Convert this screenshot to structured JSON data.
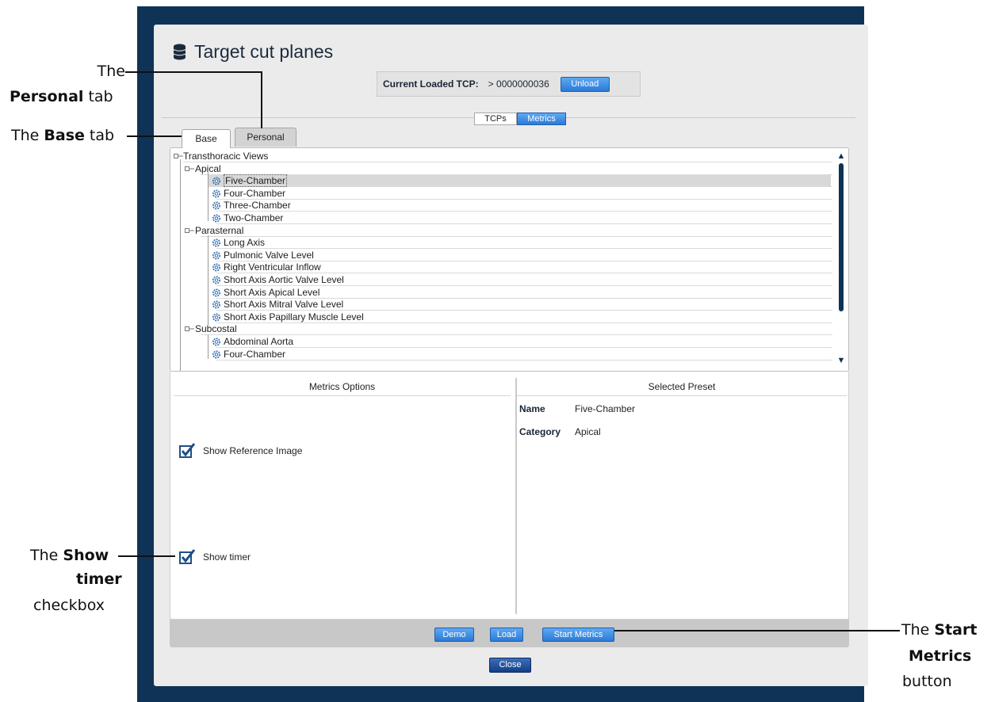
{
  "dialog": {
    "title": "Target cut planes",
    "current_tcp_label": "Current Loaded TCP:",
    "current_tcp_value": "> 0000000036",
    "unload_label": "Unload",
    "segment_tcps": "TCPs",
    "segment_metrics": "Metrics",
    "tabs": [
      "Base",
      "Personal"
    ],
    "tree": {
      "root": "Transthoracic Views",
      "groups": [
        {
          "label": "Apical",
          "items": [
            "Five-Chamber",
            "Four-Chamber",
            "Three-Chamber",
            "Two-Chamber"
          ]
        },
        {
          "label": "Parasternal",
          "items": [
            "Long Axis",
            "Pulmonic Valve Level",
            "Right Ventricular Inflow",
            "Short Axis Aortic Valve Level",
            "Short Axis Apical Level",
            "Short Axis Mitral Valve Level",
            "Short Axis Papillary Muscle Level"
          ]
        },
        {
          "label": "Subcostal",
          "items": [
            "Abdominal Aorta",
            "Four-Chamber"
          ]
        }
      ],
      "selected": "Five-Chamber"
    },
    "metrics_options_header": "Metrics Options",
    "show_reference_label": "Show Reference Image",
    "show_timer_label": "Show timer",
    "show_reference_checked": true,
    "show_timer_checked": true,
    "selected_preset_header": "Selected Preset",
    "preset_name_key": "Name",
    "preset_name_value": "Five-Chamber",
    "preset_category_key": "Category",
    "preset_category_value": "Apical",
    "demo_label": "Demo",
    "load_label": "Load",
    "start_metrics_label": "Start Metrics",
    "close_label": "Close"
  },
  "callouts": {
    "personal_1": "The",
    "personal_2_bold": "Personal",
    "personal_2_rest": " tab",
    "base_1": "The ",
    "base_bold": "Base",
    "base_rest": " tab",
    "timer_1": "The ",
    "timer_1_bold": "Show",
    "timer_2_bold": "timer",
    "timer_3": "checkbox",
    "start_1": "The ",
    "start_1_bold": "Start",
    "start_2_bold": "Metrics",
    "start_3": "button"
  },
  "colors": {
    "frame": "#0e3356",
    "accent_blue": "#2a7ad6",
    "dialog_bg": "#ebebeb"
  }
}
